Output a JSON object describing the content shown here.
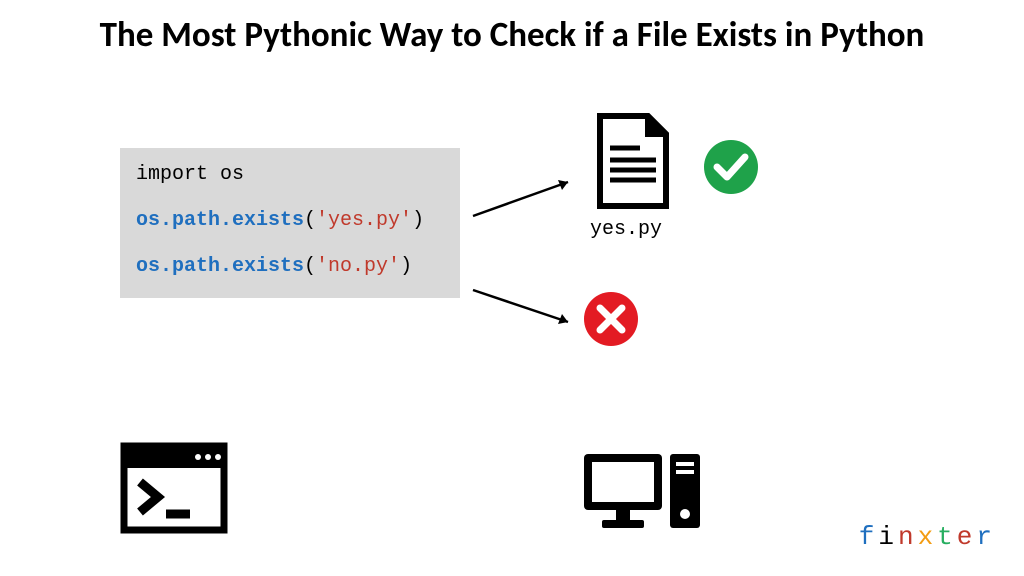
{
  "title": "The Most Pythonic Way to Check if a File Exists in Python",
  "code": {
    "line1_plain": "import os",
    "line2_kw": "os.path.exists",
    "line2_open": "(",
    "line2_str": "'yes.py'",
    "line2_close": ")",
    "line3_kw": "os.path.exists",
    "line3_open": "(",
    "line3_str": "'no.py'",
    "line3_close": ")"
  },
  "file_label": "yes.py",
  "brand": {
    "c1": "f",
    "c2": "i",
    "c3": "n",
    "c4": "x",
    "c5": "t",
    "c6": "e",
    "c7": "r"
  },
  "colors": {
    "success": "#1fa24a",
    "error": "#e31b23",
    "keyword": "#1f6fbf",
    "string": "#c0392b",
    "codebg": "#d9d9d9"
  }
}
